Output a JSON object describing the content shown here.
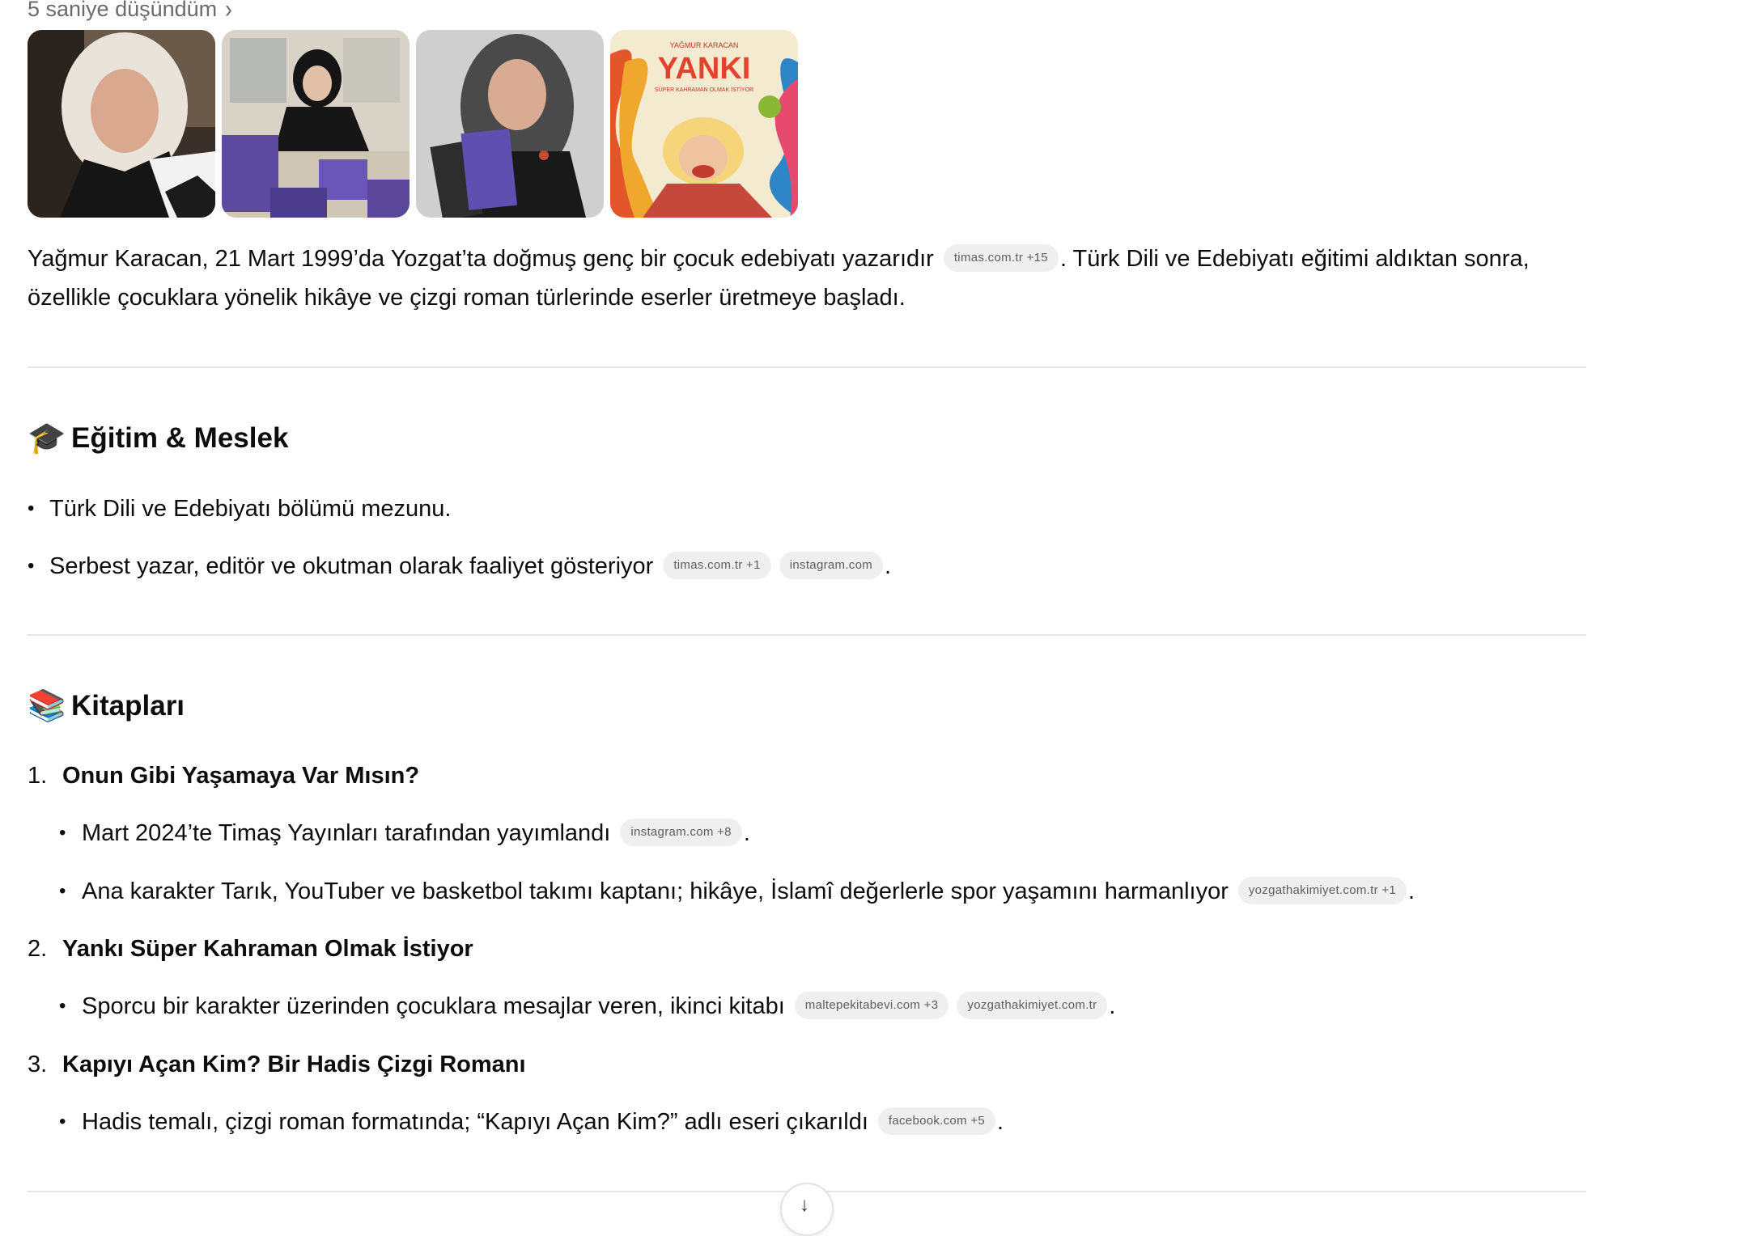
{
  "thinking": {
    "label": "5 saniye düşündüm",
    "chevron": "›"
  },
  "images": [
    {
      "name": "author-portrait-outdoor"
    },
    {
      "name": "author-signing-books"
    },
    {
      "name": "author-holding-books"
    },
    {
      "name": "book-cover-yanki",
      "cover_top": "YAĞMUR KARACAN",
      "cover_title": "YANKI",
      "cover_subtitle": "SÜPER KAHRAMAN OLMAK İSTİYOR"
    }
  ],
  "intro": {
    "text1": "Yağmur Karacan, 21 Mart 1999’da Yozgat’ta doğmuş genç bir çocuk edebiyatı yazarıdır",
    "chip1": "timas.com.tr +15",
    "text2": ". Türk Dili ve Edebiyatı eğitimi aldıktan sonra, özellikle çocuklara yönelik hikâye ve çizgi roman türlerinde eserler üretmeye başladı."
  },
  "education": {
    "emoji": "🎓",
    "title": "Eğitim & Meslek",
    "items": [
      {
        "text": "Türk Dili ve Edebiyatı bölümü mezunu."
      },
      {
        "text": "Serbest yazar, editör ve okutman olarak faaliyet gösteriyor",
        "chips": [
          "timas.com.tr +1",
          "instagram.com"
        ],
        "tail": "."
      }
    ]
  },
  "books": {
    "emoji": "📚",
    "title": "Kitapları",
    "list": [
      {
        "num": "1.",
        "title": "Onun Gibi Yaşamaya Var Mısın?",
        "subs": [
          {
            "text": "Mart 2024’te Timaş Yayınları tarafından yayımlandı",
            "chips": [
              "instagram.com +8"
            ],
            "tail": "."
          },
          {
            "text": "Ana karakter Tarık, YouTuber ve basketbol takımı kaptanı; hikâye, İslamî değerlerle spor yaşamını harmanlıyor",
            "chips": [
              "yozgathakimiyet.com.tr +1"
            ],
            "tail": "."
          }
        ]
      },
      {
        "num": "2.",
        "title": "Yankı Süper Kahraman Olmak İstiyor",
        "subs": [
          {
            "text": "Sporcu bir karakter üzerinden çocuklara mesajlar veren, ikinci kitabı",
            "chips": [
              "maltepekitabevi.com +3",
              "yozgathakimiyet.com.tr"
            ],
            "tail": "."
          }
        ]
      },
      {
        "num": "3.",
        "title": "Kapıyı Açan Kim? Bir Hadis Çizgi Romanı",
        "subs": [
          {
            "text": "Hadis temalı, çizgi roman formatında; “Kapıyı Açan Kim?” adlı eseri çıkarıldı",
            "chips": [
              "facebook.com +5"
            ],
            "tail": "."
          }
        ]
      }
    ]
  },
  "scroll_button": {
    "icon": "arrow-down-icon",
    "glyph": "↓"
  },
  "bullet": "•"
}
